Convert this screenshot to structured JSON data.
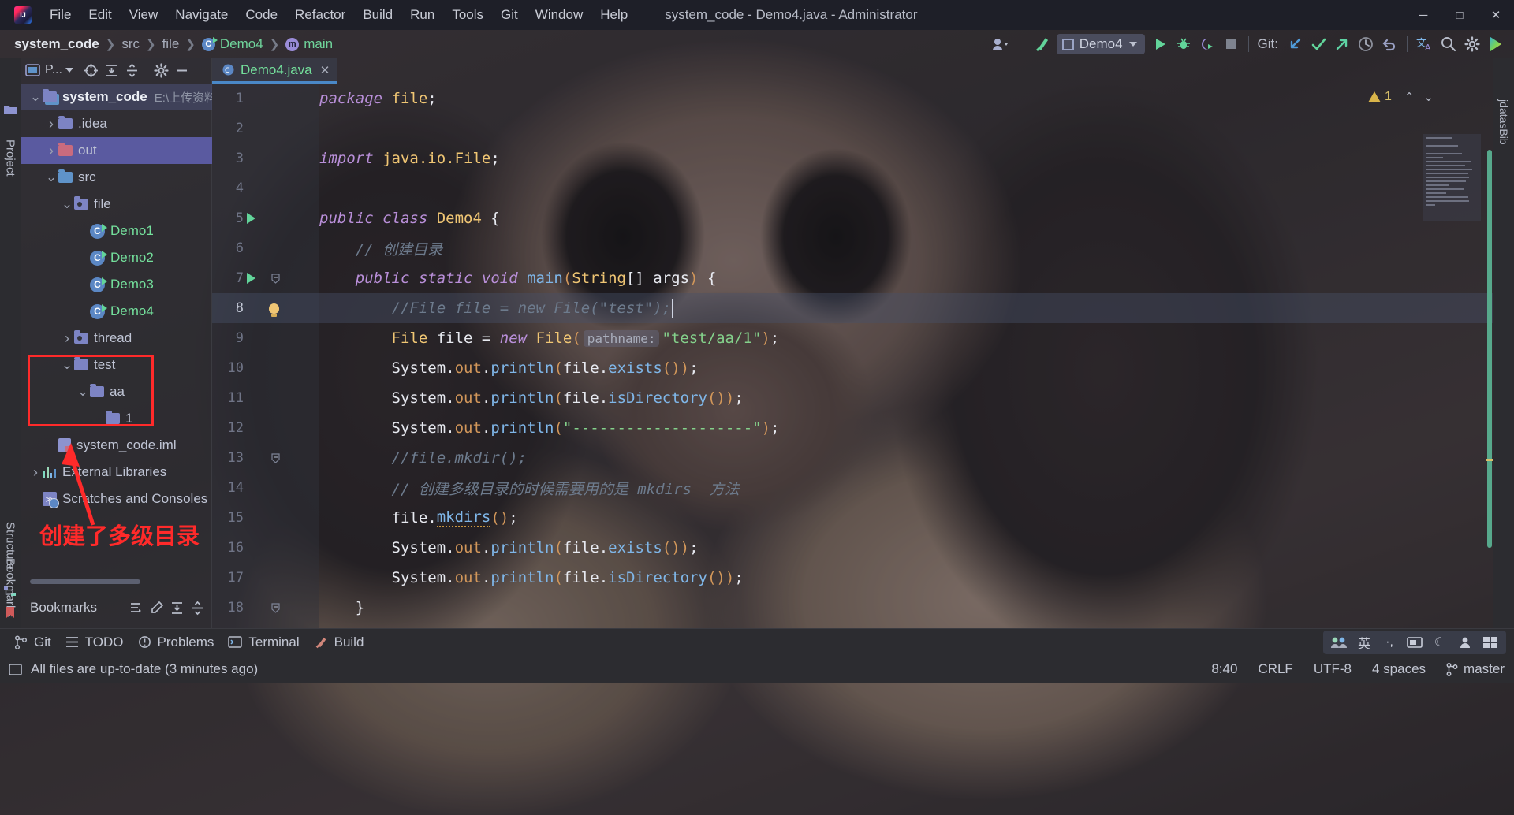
{
  "window": {
    "title": "system_code - Demo4.java - Administrator",
    "logo": "intellij-idea-logo",
    "controls": [
      "minimize",
      "maximize",
      "close"
    ]
  },
  "menu": [
    {
      "label": "File",
      "mnemonic": "F"
    },
    {
      "label": "Edit",
      "mnemonic": "E"
    },
    {
      "label": "View",
      "mnemonic": "V"
    },
    {
      "label": "Navigate",
      "mnemonic": "N"
    },
    {
      "label": "Code",
      "mnemonic": "C"
    },
    {
      "label": "Refactor",
      "mnemonic": "R"
    },
    {
      "label": "Build",
      "mnemonic": "B"
    },
    {
      "label": "Run",
      "mnemonic": "u"
    },
    {
      "label": "Tools",
      "mnemonic": "T"
    },
    {
      "label": "Git",
      "mnemonic": "G"
    },
    {
      "label": "Window",
      "mnemonic": "W"
    },
    {
      "label": "Help",
      "mnemonic": "H"
    }
  ],
  "breadcrumbs": [
    {
      "label": "system_code",
      "icon": "",
      "style": "bold"
    },
    {
      "label": "src",
      "icon": "",
      "style": "normal"
    },
    {
      "label": "file",
      "icon": "",
      "style": "normal"
    },
    {
      "label": "Demo4",
      "icon": "java-class-icon",
      "style": "green"
    },
    {
      "label": "main",
      "icon": "java-method-icon",
      "style": "green"
    }
  ],
  "toolbar": {
    "account_icon": "user-account-icon",
    "build_icon": "build-hammer-icon",
    "run_config": {
      "name": "Demo4",
      "icon": "run-config-icon"
    },
    "run_icon": "run-play-icon",
    "debug_icon": "debug-bug-icon",
    "run_coverage_icon": "run-with-coverage-icon",
    "stop_icon": "stop-icon",
    "git_label": "Git:",
    "git_update_icon": "git-update-project-icon",
    "git_commit_icon": "git-commit-checkmark-icon",
    "git_push_icon": "git-push-icon",
    "git_history_icon": "git-history-clock-icon",
    "git_rollback_icon": "git-rollback-undo-icon",
    "translate_icon": "translate-icon",
    "search_icon": "search-everywhere-icon",
    "settings_icon": "settings-gear-icon",
    "plugin_icon": "colored-plugin-icon"
  },
  "left_strip": {
    "tabs": [
      {
        "label": "Project",
        "icon": "project-folder-icon"
      },
      {
        "label": "Structure",
        "icon": "structure-icon"
      },
      {
        "label": "Bookmarks",
        "icon": "bookmarks-flag-icon"
      }
    ]
  },
  "project_panel": {
    "selector_label": "P...",
    "buttons": [
      "locate-target-icon",
      "expand-all-icon",
      "collapse-all-icon",
      "panel-settings-gear-icon",
      "hide-panel-icon"
    ],
    "tree": [
      {
        "label": "system_code",
        "path": "E:\\上传资料至",
        "icon": "module-folder-icon",
        "indent": 0,
        "twisty": "open",
        "style": "bold",
        "selected": "root"
      },
      {
        "label": ".idea",
        "icon": "folder-icon",
        "indent": 1,
        "twisty": "closed",
        "style": "normal"
      },
      {
        "label": "out",
        "icon": "folder-excluded-icon",
        "indent": 1,
        "twisty": "closed",
        "style": "normal",
        "selected": "yes"
      },
      {
        "label": "src",
        "icon": "source-folder-icon",
        "indent": 1,
        "twisty": "open",
        "style": "normal"
      },
      {
        "label": "file",
        "icon": "package-folder-icon",
        "indent": 2,
        "twisty": "open",
        "style": "normal"
      },
      {
        "label": "Demo1",
        "icon": "java-class-runnable-icon",
        "indent": 3,
        "twisty": "none",
        "style": "green"
      },
      {
        "label": "Demo2",
        "icon": "java-class-runnable-icon",
        "indent": 3,
        "twisty": "none",
        "style": "green"
      },
      {
        "label": "Demo3",
        "icon": "java-class-runnable-icon",
        "indent": 3,
        "twisty": "none",
        "style": "green"
      },
      {
        "label": "Demo4",
        "icon": "java-class-runnable-icon",
        "indent": 3,
        "twisty": "none",
        "style": "green"
      },
      {
        "label": "thread",
        "icon": "package-folder-icon",
        "indent": 2,
        "twisty": "closed",
        "style": "normal"
      },
      {
        "label": "test",
        "icon": "folder-icon",
        "indent": 2,
        "twisty": "open",
        "style": "normal"
      },
      {
        "label": "aa",
        "icon": "folder-icon",
        "indent": 3,
        "twisty": "open",
        "style": "normal"
      },
      {
        "label": "1",
        "icon": "folder-icon",
        "indent": 4,
        "twisty": "none",
        "style": "normal"
      },
      {
        "label": "system_code.iml",
        "icon": "iml-module-file-icon",
        "indent": 1,
        "twisty": "none",
        "style": "normal"
      },
      {
        "label": "External Libraries",
        "icon": "external-libraries-icon",
        "indent": 0,
        "twisty": "closed",
        "style": "normal"
      },
      {
        "label": "Scratches and Consoles",
        "icon": "scratches-consoles-icon",
        "indent": 0,
        "twisty": "none",
        "style": "normal"
      }
    ]
  },
  "annotation": {
    "text": "创建了多级目录",
    "color": "#ff2a2a",
    "box_target": "test-aa-1-folders",
    "arrow": "red-arrow-pointing-up-to-folders"
  },
  "bookmarks_panel": {
    "title": "Bookmarks",
    "buttons": [
      "group-bookmarks-icon",
      "edit-icon",
      "expand-all-icon",
      "collapse-all-icon"
    ]
  },
  "editor": {
    "tab": {
      "label": "Demo4.java",
      "icon": "java-class-icon",
      "close": "✕"
    },
    "more_icon": "more-options-vertical-icon",
    "inspections": {
      "warning_count": "1",
      "warning_icon": "warning-triangle-icon",
      "up_icon": "chevron-up-icon",
      "down_icon": "chevron-down-icon"
    },
    "lines": [
      {
        "num": "1",
        "gutter": "",
        "fold": "",
        "tokens": [
          {
            "t": "package ",
            "c": "kw"
          },
          {
            "t": "file",
            "c": "ty"
          },
          {
            "t": ";",
            "c": "id"
          }
        ]
      },
      {
        "num": "2",
        "gutter": "",
        "fold": "",
        "tokens": []
      },
      {
        "num": "3",
        "gutter": "",
        "fold": "",
        "tokens": [
          {
            "t": "import ",
            "c": "kw"
          },
          {
            "t": "java.io.File",
            "c": "ty"
          },
          {
            "t": ";",
            "c": "id"
          }
        ]
      },
      {
        "num": "4",
        "gutter": "",
        "fold": "",
        "tokens": []
      },
      {
        "num": "5",
        "gutter": "run",
        "fold": "",
        "tokens": [
          {
            "t": "public class ",
            "c": "kw"
          },
          {
            "t": "Demo4",
            "c": "ty"
          },
          {
            "t": " {",
            "c": "id"
          }
        ]
      },
      {
        "num": "6",
        "gutter": "",
        "fold": "",
        "tokens": [
          {
            "t": "    // 创建目录",
            "c": "cm"
          }
        ]
      },
      {
        "num": "7",
        "gutter": "run",
        "fold": "minus",
        "tokens": [
          {
            "t": "    public static void ",
            "c": "kw"
          },
          {
            "t": "main",
            "c": "mth"
          },
          {
            "t": "(",
            "c": "pn"
          },
          {
            "t": "String",
            "c": "ty"
          },
          {
            "t": "[] args",
            "c": "id"
          },
          {
            "t": ")",
            "c": "pn"
          },
          {
            "t": " {",
            "c": "id"
          }
        ]
      },
      {
        "num": "8",
        "gutter": "bulb",
        "fold": "",
        "current": true,
        "caret": true,
        "tokens": [
          {
            "t": "        //File file = new File(\"test\");",
            "c": "cm"
          }
        ]
      },
      {
        "num": "9",
        "gutter": "",
        "fold": "",
        "tokens": [
          {
            "t": "        ",
            "c": "id"
          },
          {
            "t": "File",
            "c": "ty"
          },
          {
            "t": " file = ",
            "c": "id"
          },
          {
            "t": "new ",
            "c": "kw"
          },
          {
            "t": "File",
            "c": "ty"
          },
          {
            "t": "(",
            "c": "pn"
          },
          {
            "t": "pathname:",
            "c": "hint"
          },
          {
            "t": "\"test/aa/1\"",
            "c": "str"
          },
          {
            "t": ")",
            "c": "pn"
          },
          {
            "t": ";",
            "c": "id"
          }
        ]
      },
      {
        "num": "10",
        "gutter": "",
        "fold": "",
        "tokens": [
          {
            "t": "        System",
            "c": "id"
          },
          {
            "t": ".",
            "c": "id"
          },
          {
            "t": "out",
            "c": "pn"
          },
          {
            "t": ".",
            "c": "id"
          },
          {
            "t": "println",
            "c": "mth"
          },
          {
            "t": "(",
            "c": "pn"
          },
          {
            "t": "file",
            "c": "id"
          },
          {
            "t": ".",
            "c": "id"
          },
          {
            "t": "exists",
            "c": "mth"
          },
          {
            "t": "())",
            "c": "pn"
          },
          {
            "t": ";",
            "c": "id"
          }
        ]
      },
      {
        "num": "11",
        "gutter": "",
        "fold": "",
        "tokens": [
          {
            "t": "        System",
            "c": "id"
          },
          {
            "t": ".",
            "c": "id"
          },
          {
            "t": "out",
            "c": "pn"
          },
          {
            "t": ".",
            "c": "id"
          },
          {
            "t": "println",
            "c": "mth"
          },
          {
            "t": "(",
            "c": "pn"
          },
          {
            "t": "file",
            "c": "id"
          },
          {
            "t": ".",
            "c": "id"
          },
          {
            "t": "isDirectory",
            "c": "mth"
          },
          {
            "t": "())",
            "c": "pn"
          },
          {
            "t": ";",
            "c": "id"
          }
        ]
      },
      {
        "num": "12",
        "gutter": "",
        "fold": "",
        "tokens": [
          {
            "t": "        System",
            "c": "id"
          },
          {
            "t": ".",
            "c": "id"
          },
          {
            "t": "out",
            "c": "pn"
          },
          {
            "t": ".",
            "c": "id"
          },
          {
            "t": "println",
            "c": "mth"
          },
          {
            "t": "(",
            "c": "pn"
          },
          {
            "t": "\"--------------------\"",
            "c": "str"
          },
          {
            "t": ")",
            "c": "pn"
          },
          {
            "t": ";",
            "c": "id"
          }
        ]
      },
      {
        "num": "13",
        "gutter": "",
        "fold": "minus",
        "tokens": [
          {
            "t": "        //file.mkdir();",
            "c": "cm"
          }
        ]
      },
      {
        "num": "14",
        "gutter": "",
        "fold": "",
        "tokens": [
          {
            "t": "        // 创建多级目录的时候需要用的是 mkdirs  方法",
            "c": "cm"
          }
        ]
      },
      {
        "num": "15",
        "gutter": "",
        "fold": "",
        "tokens": [
          {
            "t": "        file",
            "c": "id"
          },
          {
            "t": ".",
            "c": "id"
          },
          {
            "t": "mkdirs",
            "c": "mkdirs"
          },
          {
            "t": "()",
            "c": "pn"
          },
          {
            "t": ";",
            "c": "id"
          }
        ]
      },
      {
        "num": "16",
        "gutter": "",
        "fold": "",
        "tokens": [
          {
            "t": "        System",
            "c": "id"
          },
          {
            "t": ".",
            "c": "id"
          },
          {
            "t": "out",
            "c": "pn"
          },
          {
            "t": ".",
            "c": "id"
          },
          {
            "t": "println",
            "c": "mth"
          },
          {
            "t": "(",
            "c": "pn"
          },
          {
            "t": "file",
            "c": "id"
          },
          {
            "t": ".",
            "c": "id"
          },
          {
            "t": "exists",
            "c": "mth"
          },
          {
            "t": "())",
            "c": "pn"
          },
          {
            "t": ";",
            "c": "id"
          }
        ]
      },
      {
        "num": "17",
        "gutter": "",
        "fold": "",
        "tokens": [
          {
            "t": "        System",
            "c": "id"
          },
          {
            "t": ".",
            "c": "id"
          },
          {
            "t": "out",
            "c": "pn"
          },
          {
            "t": ".",
            "c": "id"
          },
          {
            "t": "println",
            "c": "mth"
          },
          {
            "t": "(",
            "c": "pn"
          },
          {
            "t": "file",
            "c": "id"
          },
          {
            "t": ".",
            "c": "id"
          },
          {
            "t": "isDirectory",
            "c": "mth"
          },
          {
            "t": "())",
            "c": "pn"
          },
          {
            "t": ";",
            "c": "id"
          }
        ]
      },
      {
        "num": "18",
        "gutter": "",
        "fold": "minus",
        "tokens": [
          {
            "t": "    }",
            "c": "id"
          }
        ]
      }
    ]
  },
  "bottom_bar": {
    "items": [
      {
        "label": "Git",
        "icon": "git-branch-icon"
      },
      {
        "label": "TODO",
        "icon": "todo-list-icon"
      },
      {
        "label": "Problems",
        "icon": "problems-icon"
      },
      {
        "label": "Terminal",
        "icon": "terminal-icon"
      },
      {
        "label": "Build",
        "icon": "build-hammer-icon"
      }
    ],
    "tray_icons": [
      "users-icon",
      "ime-chinese-icon",
      "ime-punctuation-icon",
      "ime-fullwidth-icon",
      "ime-moon-icon",
      "ime-user-icon",
      "ime-keyboard-icon"
    ]
  },
  "status_bar": {
    "left_icon": "event-log-icon",
    "message": "All files are up-to-date (3 minutes ago)",
    "caret_position": "8:40",
    "line_separator": "CRLF",
    "encoding": "UTF-8",
    "indent": "4 spaces",
    "branch": "master",
    "branch_icon": "git-branch-icon"
  },
  "colors": {
    "accent_green": "#74e09c",
    "annotation_red": "#ff2a2a",
    "selection_blue": "#5a5aa0",
    "tab_underline": "#4a88c7"
  }
}
